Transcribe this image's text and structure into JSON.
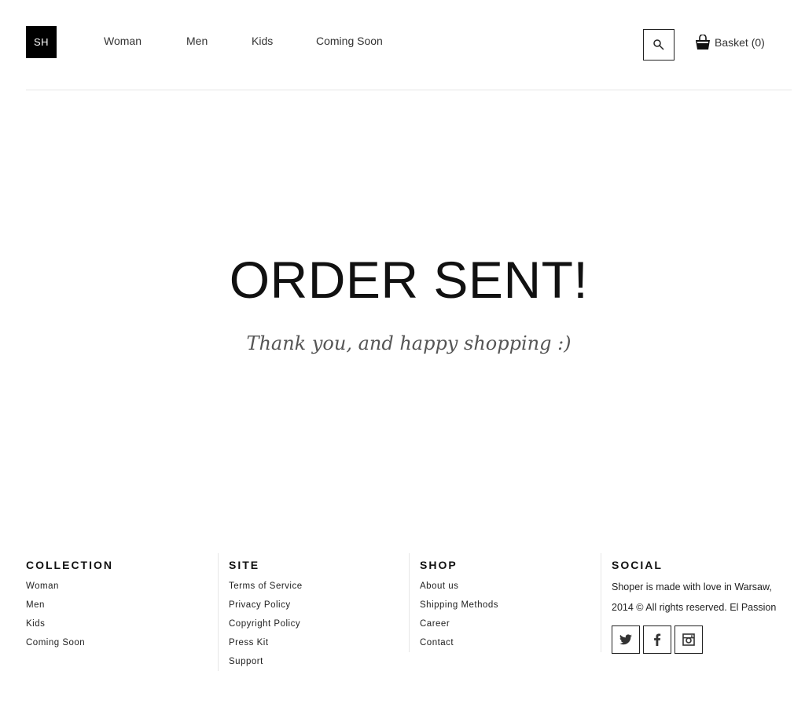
{
  "header": {
    "logo": "SH",
    "nav": [
      "Woman",
      "Men",
      "Kids",
      "Coming Soon"
    ],
    "basket_label": "Basket (0)"
  },
  "main": {
    "headline": "ORDER SENT!",
    "subline": "Thank you, and happy shopping :)"
  },
  "footer": {
    "collection": {
      "title": "COLLECTION",
      "links": [
        "Woman",
        "Men",
        "Kids",
        "Coming Soon"
      ]
    },
    "site": {
      "title": "SITE",
      "links": [
        "Terms of Service",
        "Privacy Policy",
        "Copyright Policy",
        "Press Kit",
        "Support"
      ]
    },
    "shop": {
      "title": "SHOP",
      "links": [
        "About us",
        "Shipping Methods",
        "Career",
        "Contact"
      ]
    },
    "social": {
      "title": "SOCIAL",
      "text_line1": "Shoper is made with love in Warsaw,",
      "text_line2": "2014 © All rights reserved. El Passion",
      "icons": [
        "twitter-icon",
        "facebook-icon",
        "instagram-icon"
      ]
    }
  },
  "colors": {
    "text": "#222222",
    "logo_bg": "#000000",
    "divider": "#e6e6e6"
  }
}
